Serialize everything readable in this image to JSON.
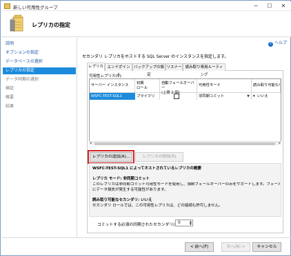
{
  "window": {
    "title": "新しい可用性グループ",
    "heading": "レプリカの指定"
  },
  "help_label": "ヘルプ",
  "nav": {
    "items": [
      {
        "label": "説明",
        "state": "normal"
      },
      {
        "label": "オプションの指定",
        "state": "normal"
      },
      {
        "label": "データベースの選択",
        "state": "normal"
      },
      {
        "label": "レプリカの指定",
        "state": "selected"
      },
      {
        "label": "データ同期の選択",
        "state": "disabled"
      },
      {
        "label": "検証",
        "state": "disabled"
      },
      {
        "label": "概要",
        "state": "disabled"
      },
      {
        "label": "結果",
        "state": "disabled"
      }
    ]
  },
  "instruction": "セカンダリ レプリカをホストする SQL Server のインスタンスを指定します。",
  "tabs": [
    "レプリカ",
    "エンドポイント",
    "バックアップの設定",
    "リスナー",
    "読み取り専用ルーティング"
  ],
  "active_tab": "レプリカ",
  "available_replicas_label": "可用性レプリカ(V):",
  "grid": {
    "columns": [
      "サーバー インスタンス",
      "初期\nロール",
      "自動フェールオーバー\n(上限 2 個)",
      "可用性モード",
      "読み取り可能なセカンダ"
    ],
    "rows": [
      {
        "server": "WSFC-TEST-SQL1",
        "role": "プライマリ",
        "auto_failover": false,
        "mode": "非同期コミット",
        "readable": "いいえ"
      }
    ]
  },
  "buttons": {
    "add_replica": "レプリカの追加(A)...",
    "remove_replica": "レプリカの削除(R)",
    "prev": "< 前へ(P)",
    "next": "次へ(N) >",
    "cancel": "キャンセル"
  },
  "description": {
    "title": "WSFC-TEST-SQL1 によってホストされているレプリカの概要",
    "mode_title": "レプリカ モード: 非同期コミット",
    "mode_line1": "このレプリカは非同期コミット可用性モードを使用し、強制フェールオーバーのみをサポートします。フェールオーバー中",
    "mode_line2": "にデータ損失が発生する可能性があります。",
    "readable_title": "読み取り可能なセカンダリ: いいえ",
    "readable_line": "セカンダリ ロールでは、この可用性レプリカは、どの接続も許可しません。"
  },
  "commit": {
    "label": "コミットする必須の同期されたセカンダリ(C):",
    "value": "0"
  }
}
